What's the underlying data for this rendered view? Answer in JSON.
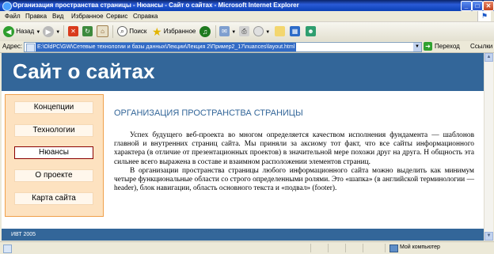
{
  "window": {
    "title": "Организация пространства страницы - Нюансы - Сайт о сайтах - Microsoft Internet Explorer",
    "controls": {
      "minimize": "_",
      "maximize": "□",
      "close": "✕"
    }
  },
  "menu": [
    "Файл",
    "Правка",
    "Вид",
    "Избранное",
    "Сервис",
    "Справка"
  ],
  "toolbar": {
    "back_label": "Назад",
    "search_label": "Поиск",
    "favorites_label": "Избранное"
  },
  "address": {
    "label": "Адрес:",
    "url": "E:\\OldPC\\GW\\Сетевые технологии и базы данных\\Лекции\\Лекция 2\\Пример2_17\\nuances\\layout.html",
    "go_label": "Переход",
    "links_label": "Ссылки"
  },
  "page": {
    "site_title": "Сайт о сайтах",
    "nav": [
      {
        "label": "Концепции",
        "active": false
      },
      {
        "label": "Технологии",
        "active": false
      },
      {
        "label": "Нюансы",
        "active": true
      },
      {
        "label": "О проекте",
        "active": false
      },
      {
        "label": "Карта сайта",
        "active": false
      }
    ],
    "heading": "ОРГАНИЗАЦИЯ ПРОСТРАНСТВА СТРАНИЦЫ",
    "paragraphs": [
      "Успех будущего веб-проекта во многом определяется качеством исполнения фундамента — шаблонов главной и внутренних страниц сайта. Мы приняли за аксиому тот факт, что все сайты информационного характера (в отличие от презентационных проектов) в значительной мере похожи друг на друга. Н общность эта сильнее всего выражена в составе и взаимном расположении элементов страниц.",
      "В организации пространства страницы любого информационного сайта можно выделить как минимум четыре функциональные области со строго определенными ролями. Это «шапка» (в английской терминологии — header), блок навигации, область основного текста и «подвал» (footer)."
    ],
    "footer": "ИВТ 2005"
  },
  "status": {
    "zone": "Мой компьютер"
  },
  "colors": {
    "header_bg": "#336699",
    "sidebar_bg": "#fde2c0",
    "sidebar_border": "#f0a04b",
    "heading": "#336699",
    "active_border": "#8b0000"
  }
}
